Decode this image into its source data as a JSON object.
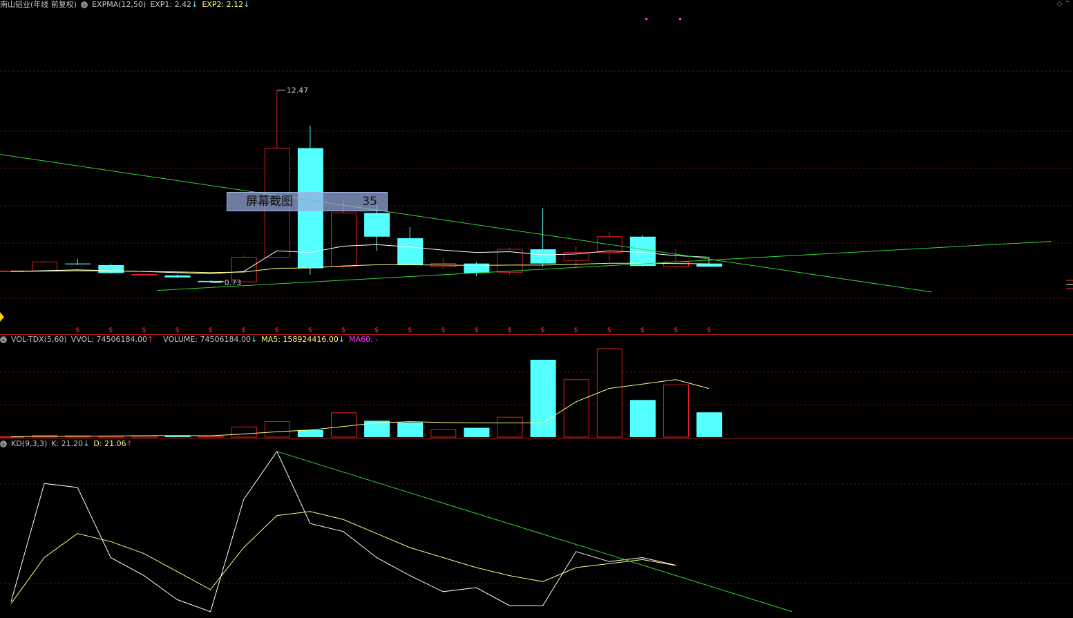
{
  "header_main": {
    "title": "南山铝业(年线 前复权)",
    "indicator": "EXPMA(12,50)",
    "exp1": "EXP1: 2.42",
    "exp1_arrow": "↓",
    "exp2": "EXP2: 2.12",
    "exp2_arrow": "↓"
  },
  "header_vol": {
    "indicator": "VOL-TDX(5,60)",
    "vvol": "VVOL: 74506184.00",
    "vvol_arrow": "↑",
    "volume": "VOLUME: 74506184.00",
    "volume_arrow": "↓",
    "ma5": "MA5: 158924416.00",
    "ma5_arrow": "↓",
    "ma60": "MA60: -"
  },
  "header_kd": {
    "indicator": "KD(9,3,3)",
    "k": "K: 21.20",
    "k_arrow": "↓",
    "d": "D: 21.06",
    "d_arrow": "↑"
  },
  "overlay": {
    "label": "屏幕截图",
    "value": "35"
  },
  "colors": {
    "up": "#e02020",
    "down": "#54ffff",
    "grid": "#5a1010",
    "trend": "#33d633",
    "exp1": "#ffffff",
    "exp2": "#ffff80",
    "ma60": "#ff40ff",
    "text": "#c8c8c8",
    "marker": "#ff3030"
  },
  "chart_data": [
    {
      "type": "candlestick",
      "title": "南山铝业(年线 前复权)",
      "annotations": {
        "high_label": "12.47",
        "low_label": "0.73"
      },
      "candles": [
        {
          "o": 1.02,
          "h": 1.06,
          "l": 0.99,
          "c": 1.03
        },
        {
          "o": 1.02,
          "h": 1.65,
          "l": 1.0,
          "c": 1.6
        },
        {
          "o": 1.5,
          "h": 1.8,
          "l": 1.4,
          "c": 1.45
        },
        {
          "o": 1.4,
          "h": 1.5,
          "l": 0.85,
          "c": 0.9
        },
        {
          "o": 0.78,
          "h": 0.88,
          "l": 0.74,
          "c": 0.81
        },
        {
          "o": 0.75,
          "h": 0.8,
          "l": 0.6,
          "c": 0.62
        },
        {
          "o": 0.4,
          "h": 0.42,
          "l": 0.3,
          "c": 0.32
        },
        {
          "o": 0.34,
          "h": 2.0,
          "l": 0.32,
          "c": 1.9
        },
        {
          "o": 1.9,
          "h": 12.47,
          "l": 1.9,
          "c": 8.8
        },
        {
          "o": 8.8,
          "h": 10.2,
          "l": 0.8,
          "c": 1.2
        },
        {
          "o": 1.3,
          "h": 5.6,
          "l": 1.25,
          "c": 4.7
        },
        {
          "o": 4.7,
          "h": 5.2,
          "l": 2.3,
          "c": 3.2
        },
        {
          "o": 3.1,
          "h": 3.8,
          "l": 1.4,
          "c": 1.4
        },
        {
          "o": 1.3,
          "h": 1.85,
          "l": 1.15,
          "c": 1.5
        },
        {
          "o": 1.5,
          "h": 1.6,
          "l": 0.7,
          "c": 0.9
        },
        {
          "o": 0.95,
          "h": 2.5,
          "l": 0.8,
          "c": 2.4
        },
        {
          "o": 2.4,
          "h": 5.0,
          "l": 1.3,
          "c": 1.5
        },
        {
          "o": 1.7,
          "h": 2.6,
          "l": 1.2,
          "c": 2.2
        },
        {
          "o": 2.2,
          "h": 3.5,
          "l": 1.6,
          "c": 3.2
        },
        {
          "o": 3.2,
          "h": 3.3,
          "l": 1.3,
          "c": 1.35
        },
        {
          "o": 1.3,
          "h": 2.4,
          "l": 1.2,
          "c": 1.6
        },
        {
          "o": 1.5,
          "h": 1.9,
          "l": 1.3,
          "c": 1.3
        }
      ],
      "exp1": [
        1.0,
        1.05,
        1.1,
        1.05,
        1.0,
        0.92,
        0.85,
        1.0,
        2.3,
        2.2,
        2.6,
        2.7,
        2.55,
        2.35,
        2.2,
        2.25,
        2.05,
        2.1,
        2.3,
        2.2,
        2.0,
        1.9
      ],
      "exp2": [
        1.0,
        1.02,
        1.04,
        1.03,
        1.0,
        0.97,
        0.93,
        0.96,
        1.2,
        1.22,
        1.35,
        1.42,
        1.42,
        1.4,
        1.38,
        1.4,
        1.4,
        1.45,
        1.52,
        1.52,
        1.5,
        1.48
      ],
      "trend_lines": [
        {
          "from": [
            -0.33,
            8.4
          ],
          "to": [
            27.7,
            -0.3
          ]
        },
        {
          "from": [
            4.4,
            -0.2
          ],
          "to": [
            31.3,
            2.9
          ]
        }
      ],
      "markers": [
        "$",
        "$",
        "$",
        "$",
        "$",
        "$",
        "$",
        "$",
        "$",
        "$",
        "$",
        "$",
        "$",
        "$",
        "$",
        "$",
        "$",
        "$",
        "$",
        "$"
      ]
    },
    {
      "type": "bar",
      "title": "VOL-TDX(5,60)",
      "volume": [
        1000000,
        4000000,
        3000000,
        2000000,
        3500000,
        2500000,
        2000000,
        23000000,
        35000000,
        16000000,
        55000000,
        37000000,
        33000000,
        17000000,
        21000000,
        45000000,
        175000000,
        130000000,
        200000000,
        84000000,
        118000000,
        56000000
      ],
      "up": [
        true,
        true,
        true,
        true,
        true,
        false,
        true,
        true,
        true,
        false,
        true,
        false,
        false,
        true,
        false,
        true,
        false,
        true,
        true,
        false,
        true,
        false
      ],
      "ma5": [
        1000000,
        1500000,
        2000000,
        2500000,
        3000000,
        3500000,
        3000000,
        7000000,
        12000000,
        16000000,
        24000000,
        32000000,
        35000000,
        33000000,
        32000000,
        32000000,
        32000000,
        80000000,
        110000000,
        120000000,
        130000000,
        110000000
      ]
    },
    {
      "type": "line",
      "title": "KD(9,3,3)",
      "k": [
        3,
        62,
        60,
        25,
        16,
        4,
        -2,
        54,
        78,
        42,
        38,
        25,
        16,
        8,
        10,
        1,
        1,
        28,
        23,
        25,
        21.2
      ],
      "d": [
        2,
        25,
        37,
        33,
        27,
        18,
        9,
        30,
        46,
        48,
        44,
        37,
        30,
        25,
        20,
        16,
        13,
        20,
        22,
        24,
        21.06
      ],
      "trend_line": {
        "from": [
          8,
          78
        ],
        "to": [
          23.5,
          -2
        ]
      }
    }
  ]
}
